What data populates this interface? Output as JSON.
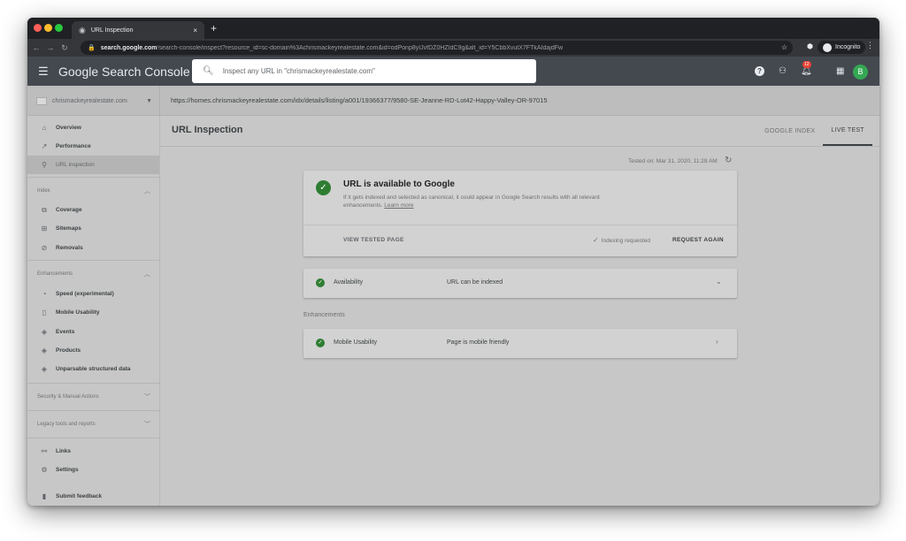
{
  "browser": {
    "tab_title": "URL Inspection",
    "tab_close": "×",
    "new_tab": "+",
    "url_host": "search.google.com",
    "url_path": "/search-console/inspect?resource_id=sc-domain%3Achrismackeyrealestate.com&id=odPonp8yIJvfDZ0HZIdC9g&alt_id=Y5CbbXvutX7FTkAIdajdFw",
    "incognito_label": "Incognito"
  },
  "app": {
    "logo": "Google Search Console",
    "search_placeholder": "Inspect any URL in \"chrismackeyrealestate.com\"",
    "notifications_count": "12",
    "avatar_letter": "B"
  },
  "property": {
    "name": "chrismackeyrealestate.com",
    "inspected_url": "https://homes.chrismackeyrealestate.com/idx/details/listing/a001/19366377/9580-SE-Jeanne-RD-Lot42-Happy-Valley-OR-97015"
  },
  "sidebar": {
    "overview": "Overview",
    "performance": "Performance",
    "url_inspection": "URL inspection",
    "index_header": "Index",
    "coverage": "Coverage",
    "sitemaps": "Sitemaps",
    "removals": "Removals",
    "enhancements_header": "Enhancements",
    "speed": "Speed (experimental)",
    "mobile_usability": "Mobile Usability",
    "events": "Events",
    "products": "Products",
    "unparsable": "Unparsable structured data",
    "security_header": "Security & Manual Actions",
    "legacy_header": "Legacy tools and reports",
    "links": "Links",
    "settings": "Settings",
    "submit_feedback": "Submit feedback"
  },
  "main": {
    "page_title": "URL Inspection",
    "tab_google_index": "GOOGLE INDEX",
    "tab_live_test": "LIVE TEST",
    "tested_on": "Tested on: Mar 31, 2020, 11:28 AM",
    "status_title": "URL is available to Google",
    "status_desc": "If it gets indexed and selected as canonical, it could appear in Google Search results with all relevant enhancements.",
    "learn_more": "Learn more",
    "view_tested_page": "VIEW TESTED PAGE",
    "indexing_requested": "Indexing requested",
    "request_again": "REQUEST AGAIN",
    "availability_label": "Availability",
    "availability_value": "URL can be indexed",
    "enhancements_label": "Enhancements",
    "mobile_label": "Mobile Usability",
    "mobile_value": "Page is mobile friendly"
  }
}
